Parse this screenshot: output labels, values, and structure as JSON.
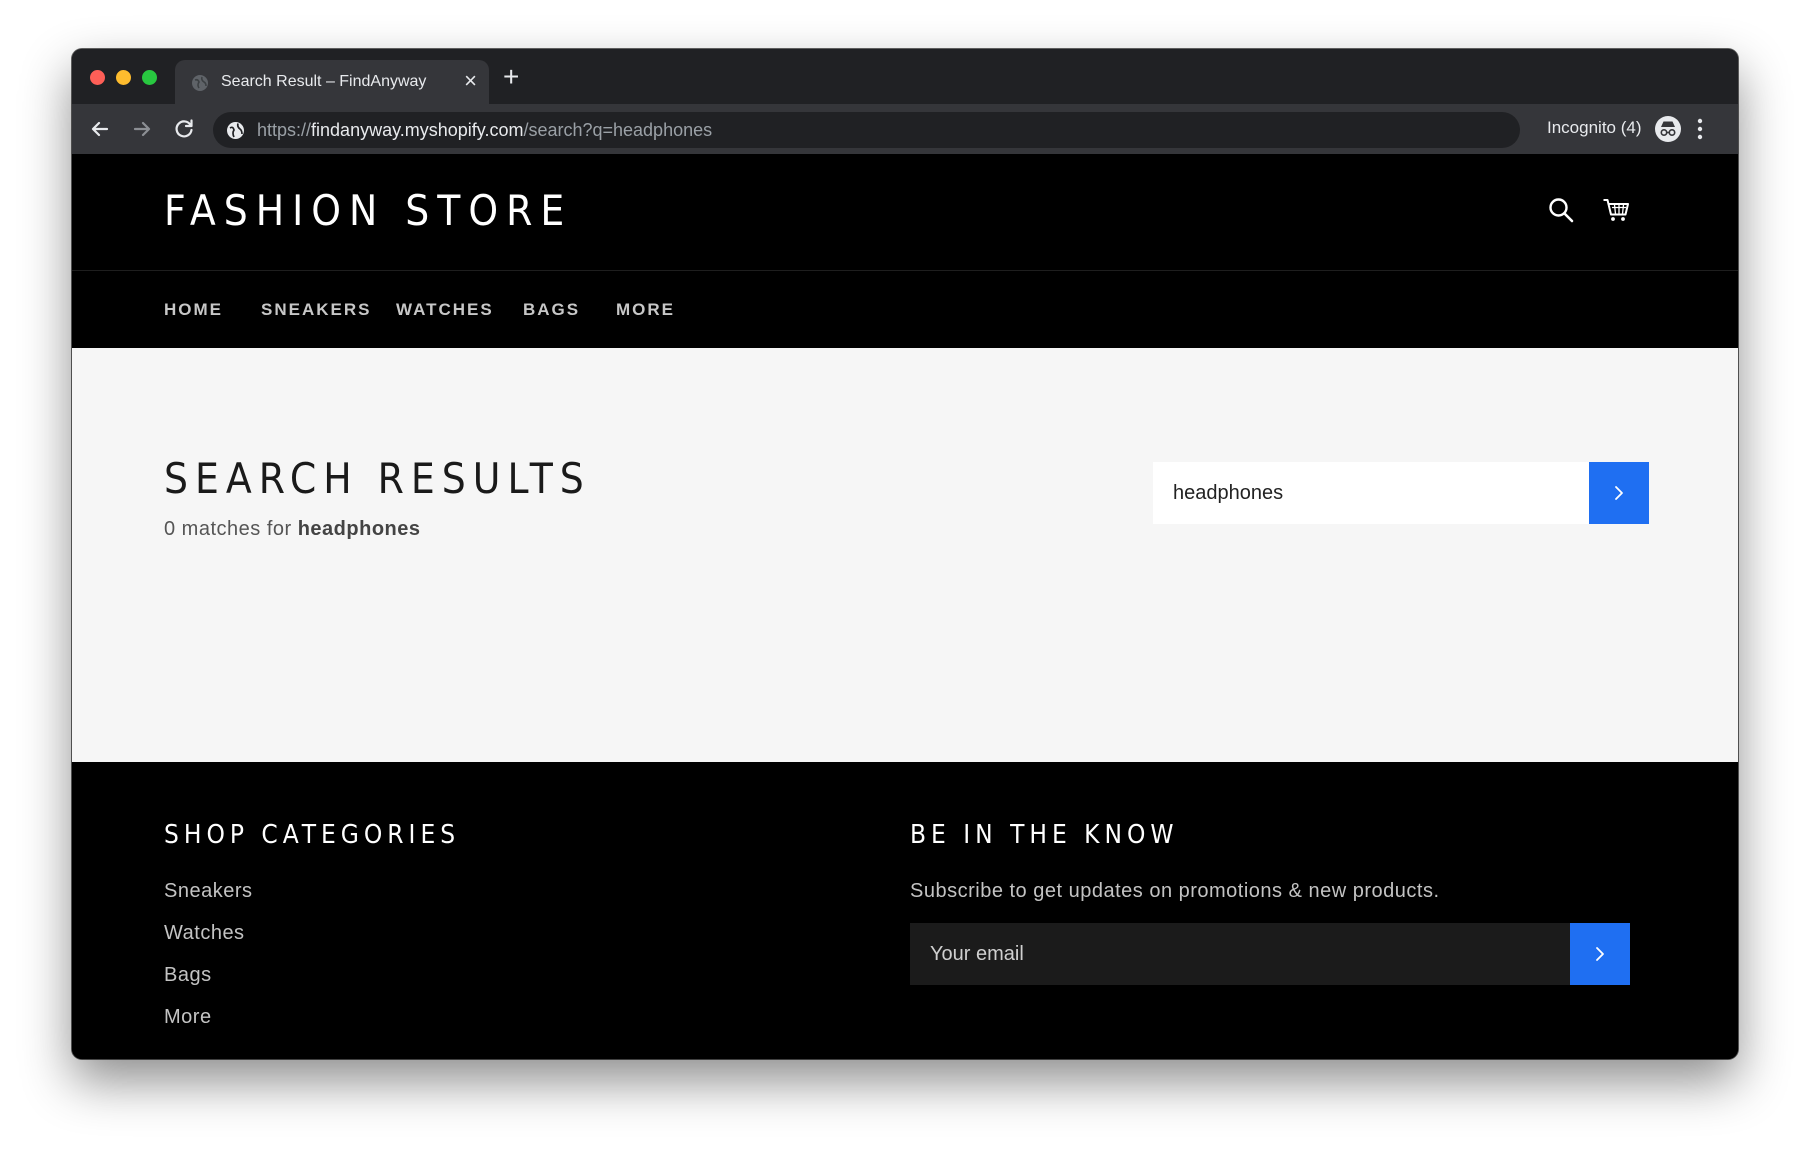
{
  "browser": {
    "tab_title": "Search Result – FindAnyway",
    "tab_close": "×",
    "new_tab": "+",
    "url_scheme": "https://",
    "url_host": "findanyway.myshopify.com",
    "url_path": "/search?q=headphones",
    "incognito_label": "Incognito (4)"
  },
  "header": {
    "brand": "FASHION STORE"
  },
  "nav": {
    "items": [
      {
        "label": "HOME"
      },
      {
        "label": "SNEAKERS"
      },
      {
        "label": "WATCHES"
      },
      {
        "label": "BAGS"
      },
      {
        "label": "MORE"
      }
    ]
  },
  "search": {
    "title": "SEARCH RESULTS",
    "matches_prefix": "0 matches for ",
    "query": "headphones",
    "input_value": "headphones"
  },
  "footer": {
    "categories_heading": "SHOP CATEGORIES",
    "links": [
      {
        "label": "Sneakers"
      },
      {
        "label": "Watches"
      },
      {
        "label": "Bags"
      },
      {
        "label": "More"
      }
    ],
    "newsletter_heading": "BE IN THE KNOW",
    "newsletter_text": "Subscribe to get updates on promotions & new products.",
    "email_placeholder": "Your email"
  },
  "colors": {
    "accent": "#1f6ff2",
    "site_bg": "#000000",
    "content_bg": "#f6f6f6",
    "chrome_dark": "#202124",
    "chrome_toolbar": "#35363a"
  },
  "icons": {
    "window_controls": [
      "close-dot",
      "minimize-dot",
      "zoom-dot"
    ],
    "toolbar": [
      "back-arrow-icon",
      "forward-arrow-icon",
      "reload-icon",
      "globe-icon",
      "incognito-icon",
      "more-vertical-icon"
    ],
    "header": [
      "search-icon",
      "cart-icon"
    ],
    "submit": "chevron-right-icon"
  }
}
